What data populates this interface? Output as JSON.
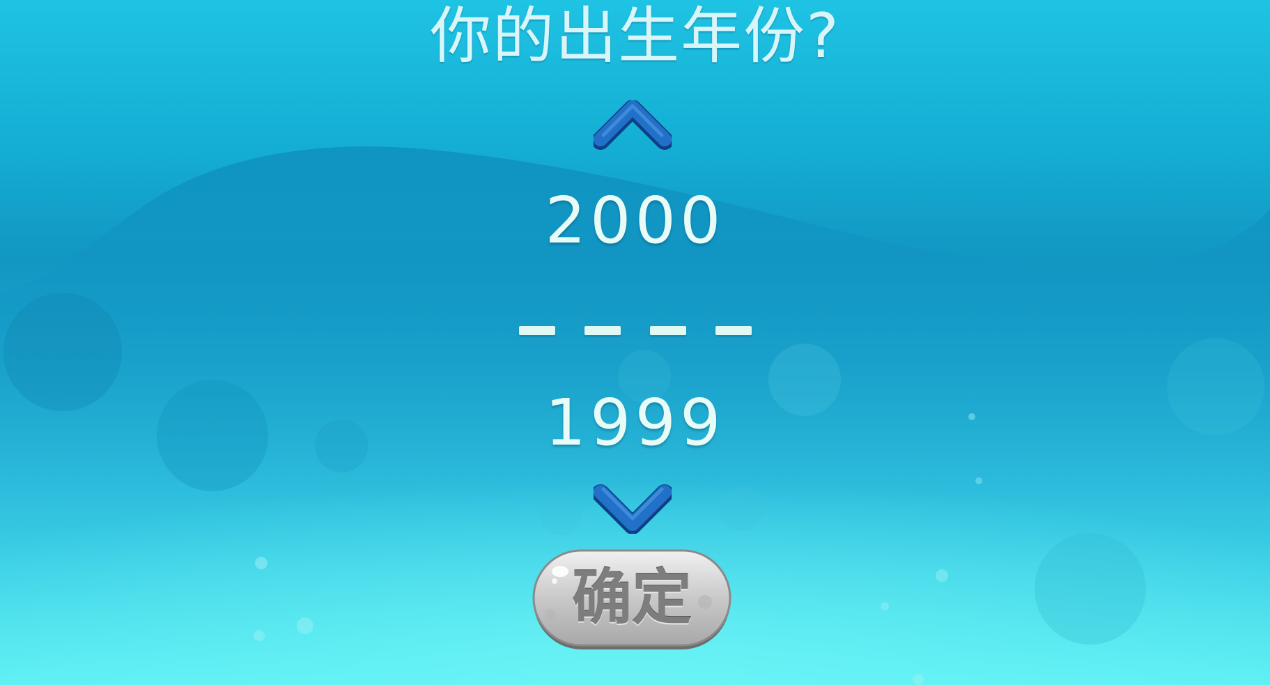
{
  "screen": {
    "question": "你的出生年份?"
  },
  "year_picker": {
    "previous_year": "2000",
    "selected_placeholder": [
      "–",
      "–",
      "–",
      "–"
    ],
    "next_year": "1999",
    "up_icon": "chevron-up-icon",
    "down_icon": "chevron-down-icon"
  },
  "confirm": {
    "label": "确定"
  },
  "colors": {
    "background_top": "#1fc3e3",
    "background_bottom": "#5cf0f4",
    "wave": "#1296c2",
    "arrow": "#1a5fb8",
    "text": "#e7fbf7",
    "button": "#bdbdbd"
  }
}
